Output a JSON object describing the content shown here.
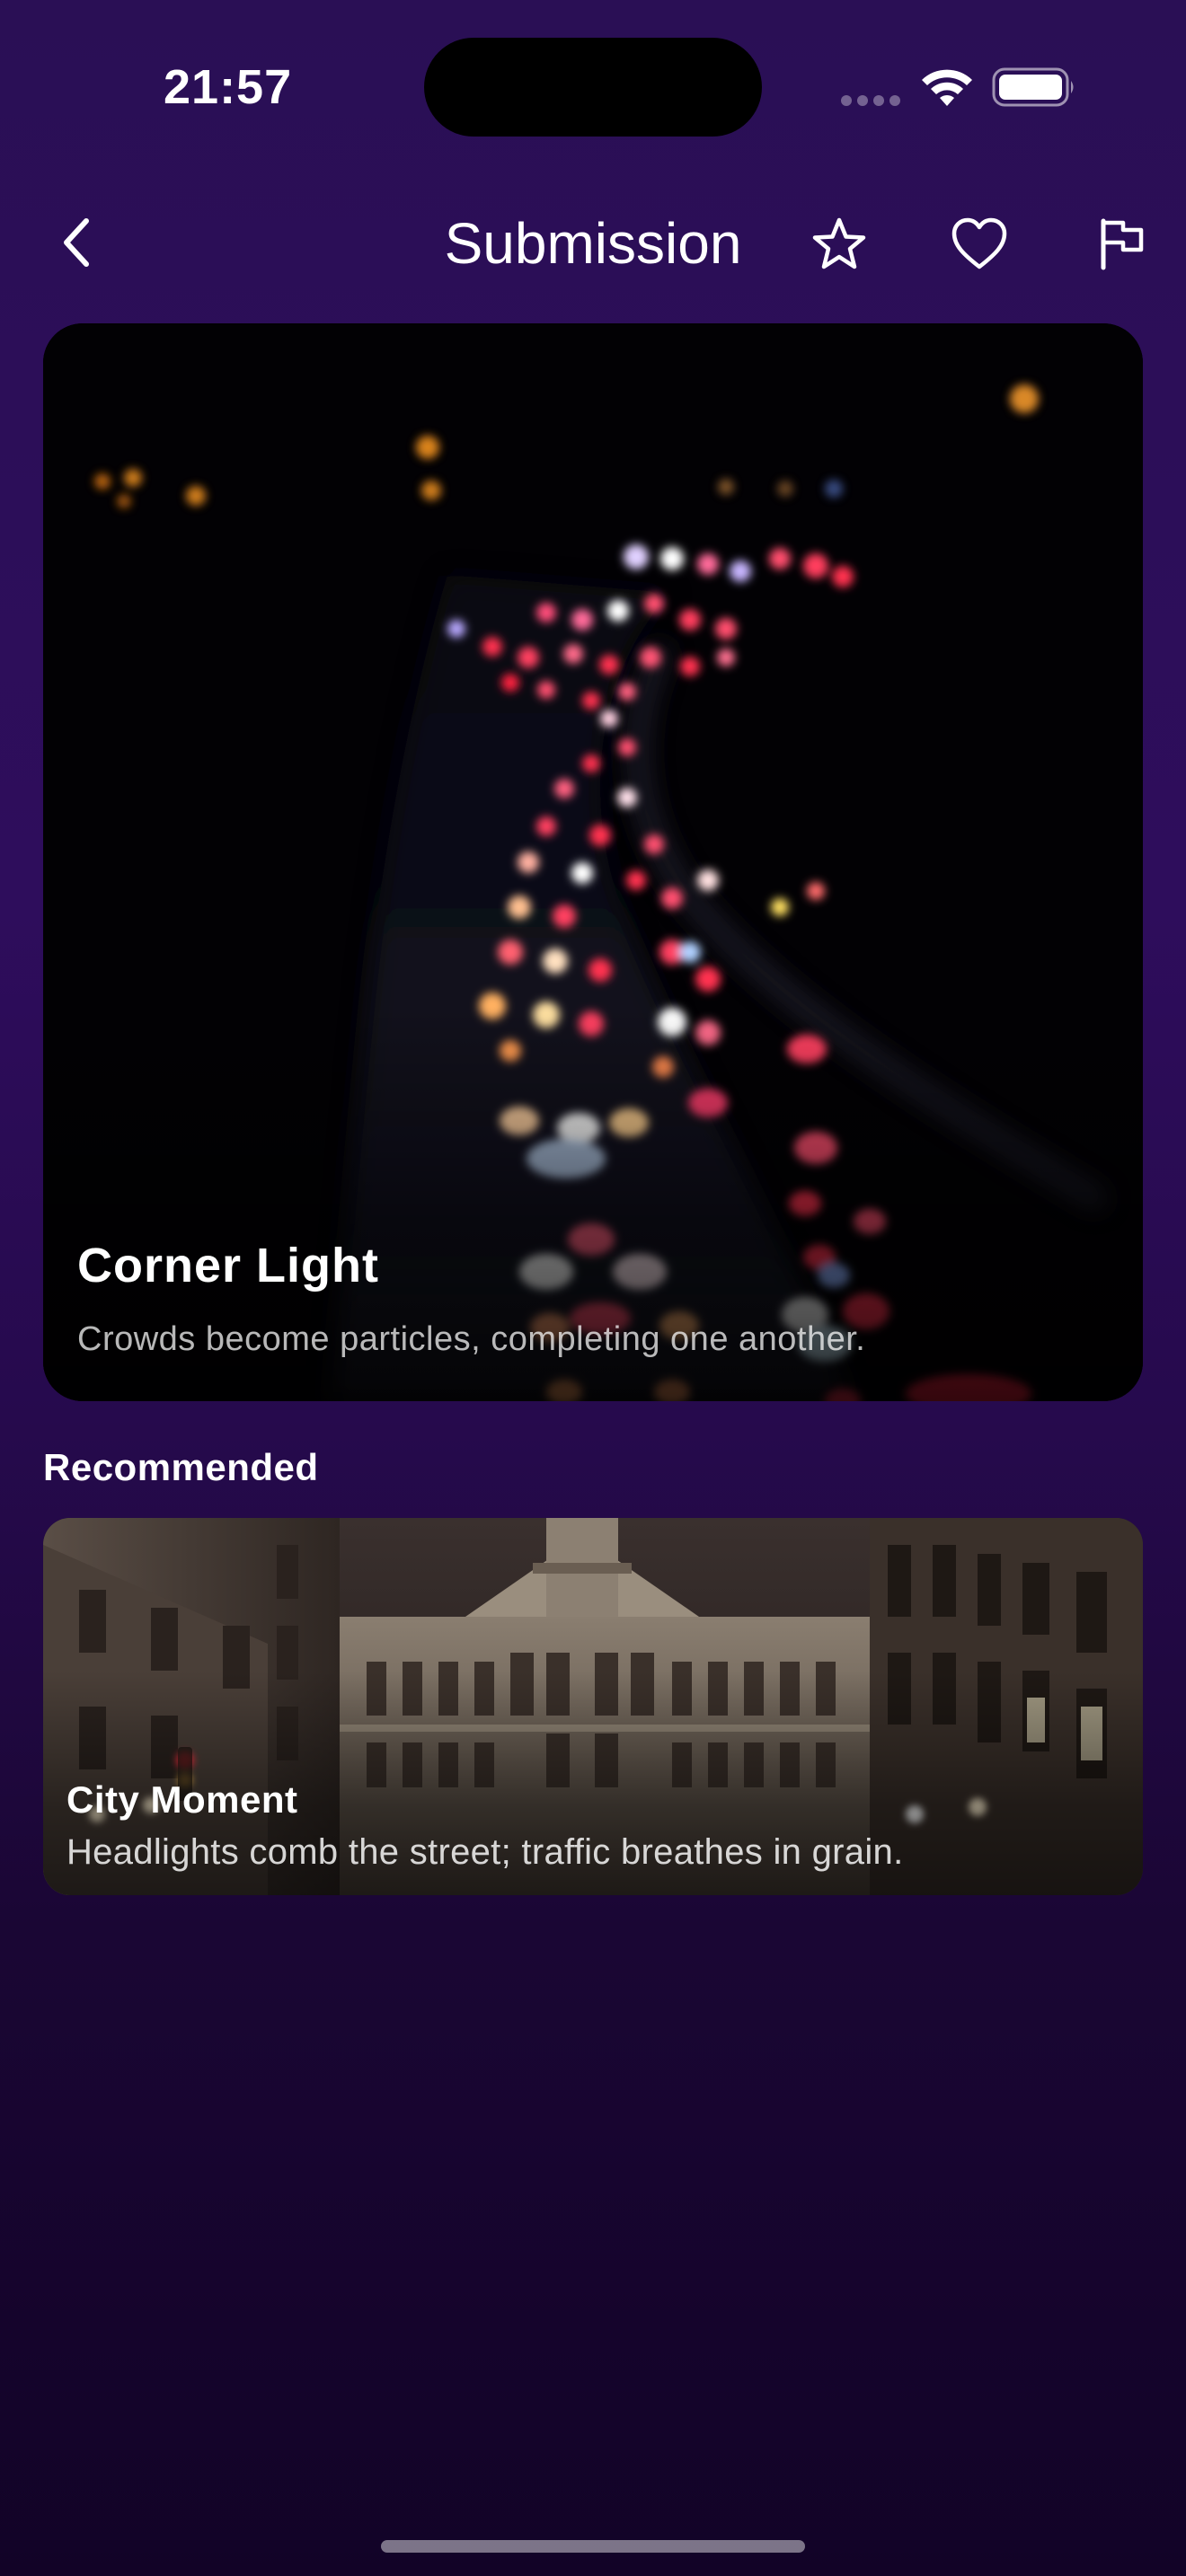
{
  "status_bar": {
    "time": "21:57"
  },
  "nav": {
    "title": "Submission",
    "icons": [
      "chevron-left-icon",
      "star-icon",
      "heart-icon",
      "flag-icon"
    ]
  },
  "hero": {
    "title": "Corner Light",
    "subtitle": "Crowds become particles, completing one another."
  },
  "recommended": {
    "heading": "Recommended",
    "items": [
      {
        "title": "City Moment",
        "subtitle": "Headlights comb the street; traffic breathes in grain."
      }
    ]
  },
  "colors": {
    "background_top": "#2a0f55",
    "background_bottom": "#120327",
    "text_primary": "#ffffff"
  }
}
